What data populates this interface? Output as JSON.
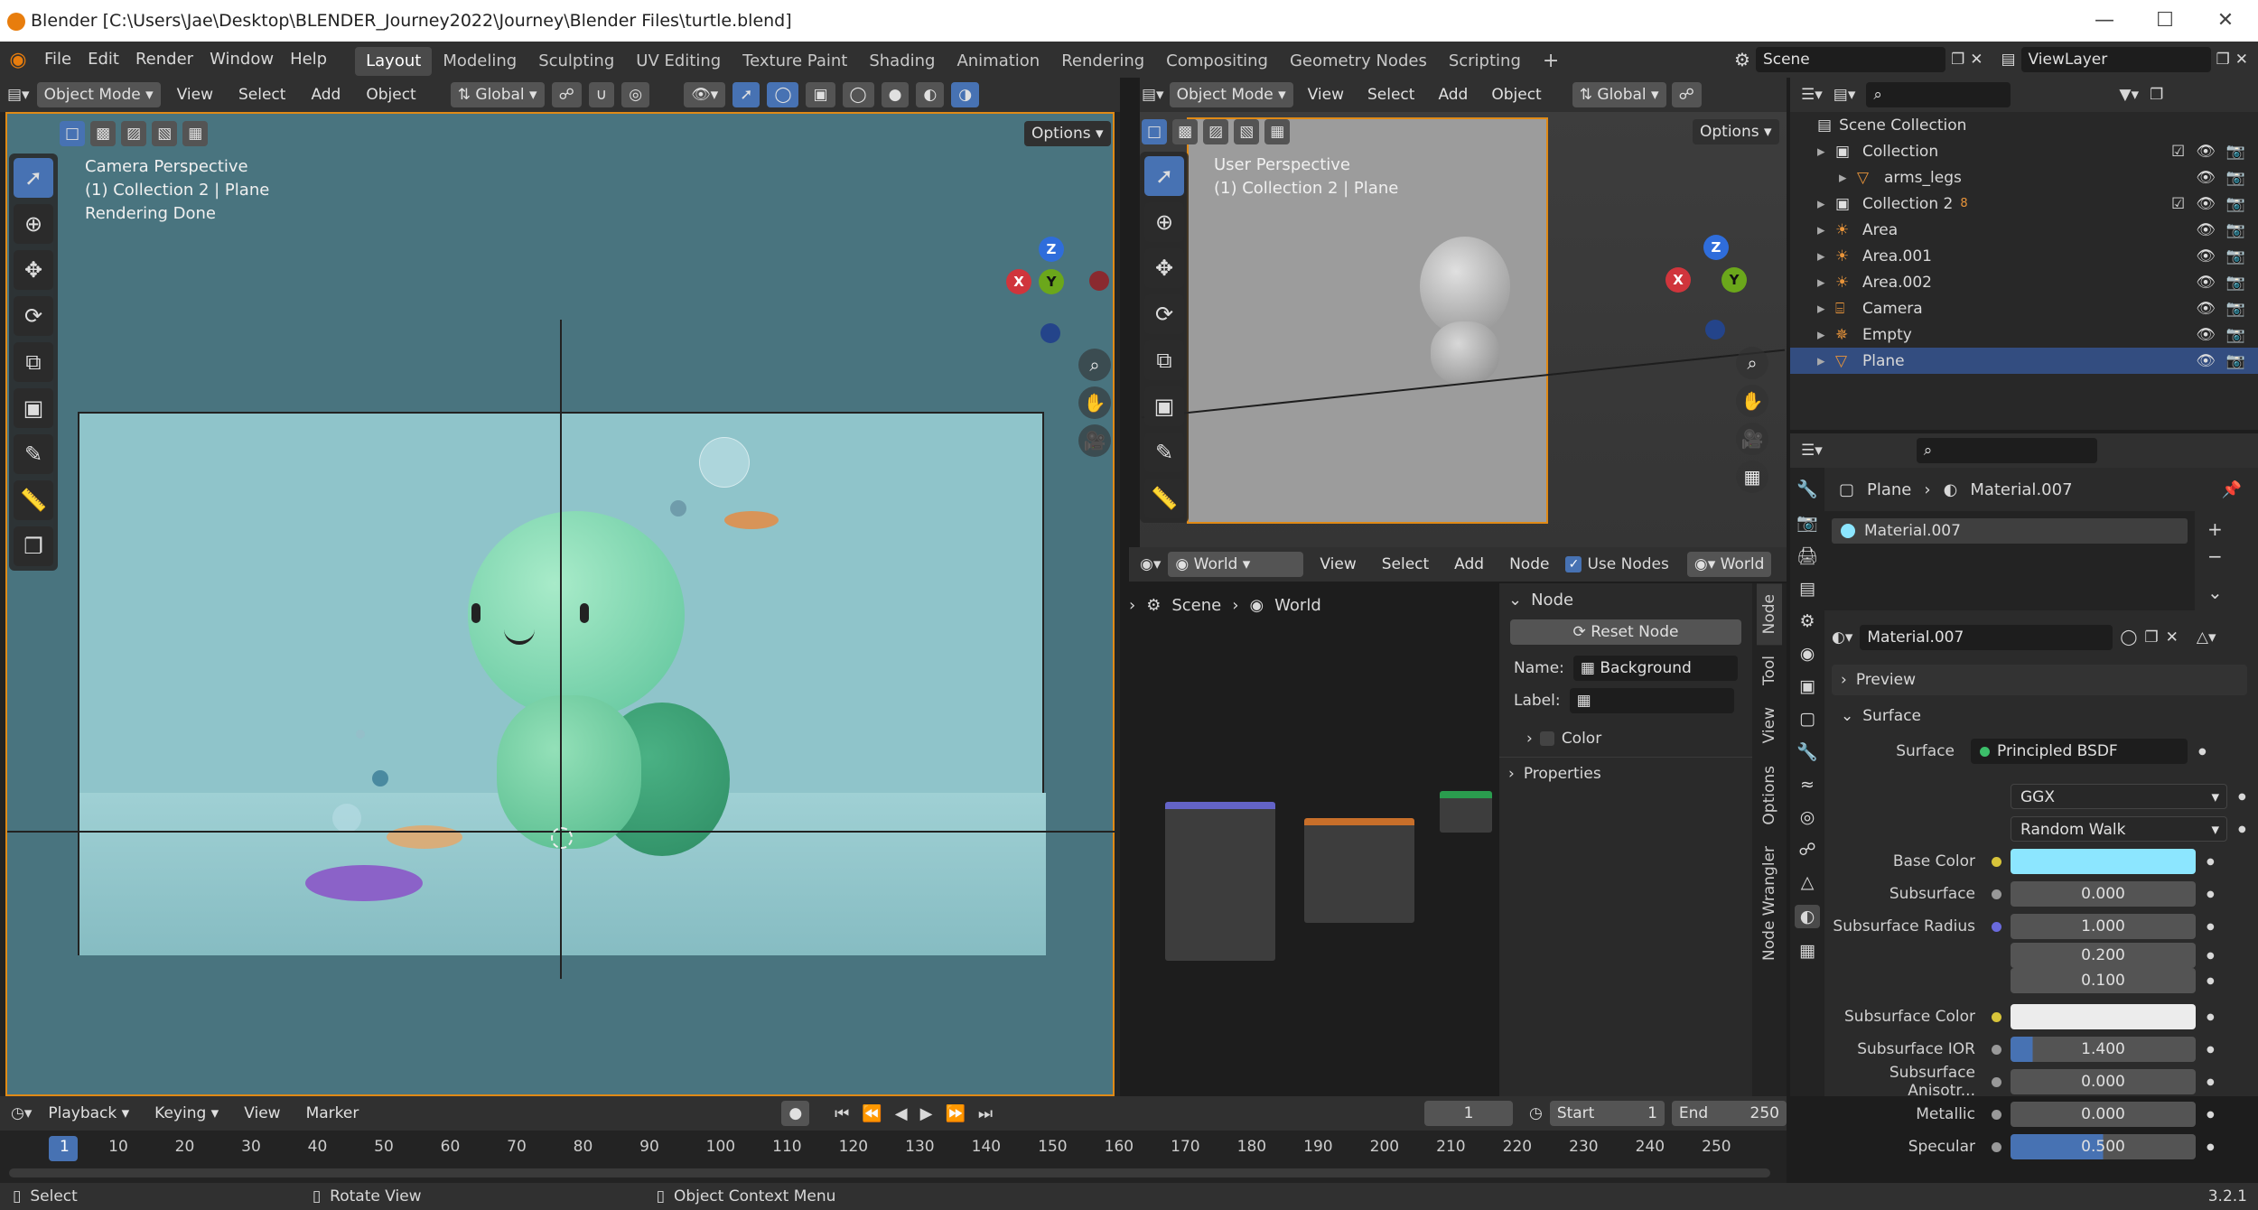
{
  "window": {
    "title": "Blender [C:\\Users\\Jae\\Desktop\\BLENDER_Journey2022\\Journey\\Blender Files\\turtle.blend]"
  },
  "menu": [
    "File",
    "Edit",
    "Render",
    "Window",
    "Help"
  ],
  "workspaces": [
    "Layout",
    "Modeling",
    "Sculpting",
    "UV Editing",
    "Texture Paint",
    "Shading",
    "Animation",
    "Rendering",
    "Compositing",
    "Geometry Nodes",
    "Scripting"
  ],
  "scene": {
    "name": "Scene",
    "view_layer": "ViewLayer"
  },
  "viewport_left": {
    "mode": "Object Mode",
    "menus": [
      "View",
      "Select",
      "Add",
      "Object"
    ],
    "orientation": "Global",
    "options": "Options",
    "info": [
      "Camera Perspective",
      "(1) Collection 2 | Plane",
      "Rendering Done"
    ]
  },
  "viewport_right": {
    "mode": "Object Mode",
    "menus": [
      "View",
      "Select",
      "Add",
      "Object"
    ],
    "orientation": "Global",
    "options": "Options",
    "info": [
      "User Perspective",
      "(1) Collection 2 | Plane"
    ]
  },
  "gizmo": {
    "z": "Z",
    "y": "Y",
    "x": "X"
  },
  "node_editor": {
    "type": "World",
    "menus": [
      "View",
      "Select",
      "Add",
      "Node"
    ],
    "use_nodes": "Use Nodes",
    "world": "World",
    "breadcrumb": [
      "Scene",
      "World"
    ],
    "panel": {
      "title": "Node",
      "reset": "Reset Node",
      "name_label": "Name:",
      "name_value": "Background",
      "label_label": "Label:",
      "color": "Color",
      "properties": "Properties"
    },
    "tabs": [
      "Node",
      "Tool",
      "View",
      "Options",
      "Node Wrangler"
    ]
  },
  "outliner": {
    "root": "Scene Collection",
    "rows": [
      {
        "name": "Collection",
        "indent": 1,
        "icon": "collection-icon"
      },
      {
        "name": "arms_legs",
        "indent": 2,
        "icon": "mesh-icon"
      },
      {
        "name": "Collection 2",
        "indent": 1,
        "icon": "collection-icon",
        "badge": "8"
      },
      {
        "name": "Area",
        "indent": 1,
        "icon": "light-icon"
      },
      {
        "name": "Area.001",
        "indent": 1,
        "icon": "light-icon"
      },
      {
        "name": "Area.002",
        "indent": 1,
        "icon": "light-icon"
      },
      {
        "name": "Camera",
        "indent": 1,
        "icon": "camera-icon"
      },
      {
        "name": "Empty",
        "indent": 1,
        "icon": "empty-icon"
      },
      {
        "name": "Plane",
        "indent": 1,
        "icon": "mesh-icon",
        "selected": true
      }
    ]
  },
  "properties": {
    "breadcrumb_object": "Plane",
    "breadcrumb_material": "Material.007",
    "slot": "Material.007",
    "material": "Material.007",
    "preview": "Preview",
    "surface_panel": "Surface",
    "rows": [
      {
        "label": "Surface",
        "value": "Principled BSDF"
      },
      {
        "label": "",
        "value": "GGX"
      },
      {
        "label": "",
        "value": "Random Walk"
      },
      {
        "label": "Base Color",
        "value": ""
      },
      {
        "label": "Subsurface",
        "value": "0.000"
      },
      {
        "label": "Subsurface Radius",
        "value": "1.000"
      },
      {
        "label": "",
        "value": "0.200"
      },
      {
        "label": "",
        "value": "0.100"
      },
      {
        "label": "Subsurface Color",
        "value": ""
      },
      {
        "label": "Subsurface IOR",
        "value": "1.400"
      },
      {
        "label": "Subsurface Anisotr...",
        "value": "0.000"
      },
      {
        "label": "Metallic",
        "value": "0.000"
      },
      {
        "label": "Specular",
        "value": "0.500"
      }
    ]
  },
  "timeline": {
    "menus": [
      "Playback",
      "Keying",
      "View",
      "Marker"
    ],
    "current": "1",
    "start_label": "Start",
    "start": "1",
    "end_label": "End",
    "end": "250",
    "ticks": [
      "1",
      "10",
      "20",
      "30",
      "40",
      "50",
      "60",
      "70",
      "80",
      "90",
      "100",
      "110",
      "120",
      "130",
      "140",
      "150",
      "160",
      "170",
      "180",
      "190",
      "200",
      "210",
      "220",
      "230",
      "240",
      "250"
    ]
  },
  "status": {
    "select": "Select",
    "rotate": "Rotate View",
    "context": "Object Context Menu",
    "version": "3.2.1"
  },
  "colors": {
    "accent": "#4772b3",
    "header": "#303030",
    "base_color": "#8ce6ff",
    "subsurface_color": "#ececec"
  }
}
